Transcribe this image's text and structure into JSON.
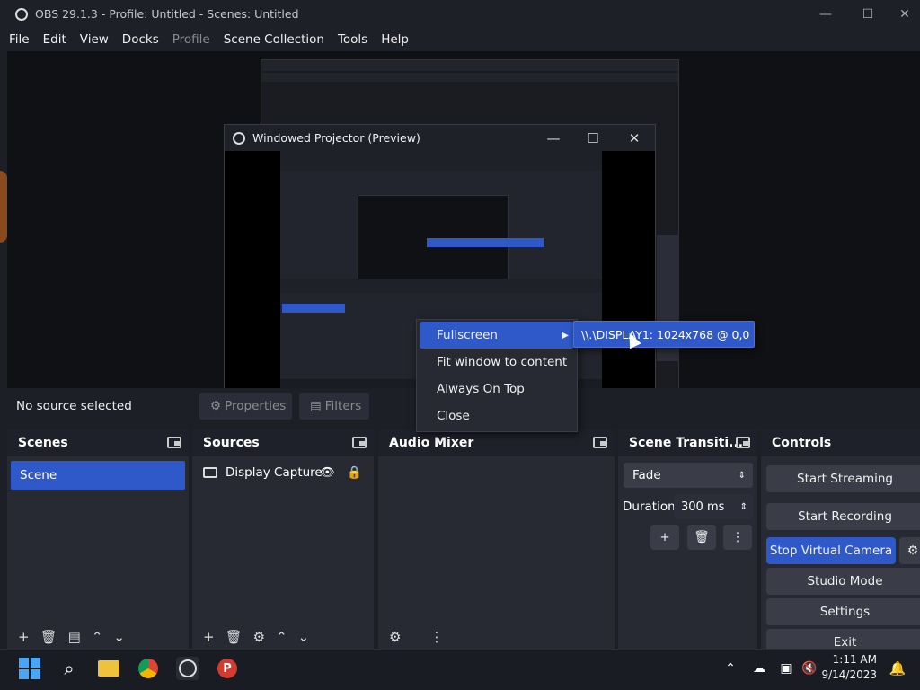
{
  "window": {
    "title": "OBS 29.1.3 - Profile: Untitled - Scenes: Untitled"
  },
  "menubar": {
    "items": [
      "File",
      "Edit",
      "View",
      "Docks",
      "Profile",
      "Scene Collection",
      "Tools",
      "Help"
    ]
  },
  "projector": {
    "title": "Windowed Projector (Preview)"
  },
  "context_menu": {
    "items": [
      "Fullscreen",
      "Fit window to content",
      "Always On Top",
      "Close"
    ],
    "submenu_item": "\\\\.\\DISPLAY1: 1024x768 @ 0,0"
  },
  "source_bar": {
    "status": "No source selected",
    "properties": "Properties",
    "filters": "Filters"
  },
  "docks": {
    "scenes": {
      "title": "Scenes",
      "items": [
        "Scene"
      ]
    },
    "sources": {
      "title": "Sources",
      "items": [
        "Display Capture"
      ]
    },
    "audio": {
      "title": "Audio Mixer"
    },
    "transitions": {
      "title": "Scene Transiti...",
      "type": "Fade",
      "duration_label": "Duration",
      "duration_value": "300 ms"
    },
    "controls": {
      "title": "Controls",
      "buttons": [
        "Start Streaming",
        "Start Recording",
        "Stop Virtual Camera",
        "Studio Mode",
        "Settings",
        "Exit"
      ]
    }
  },
  "taskbar": {
    "time": "1:11 AM",
    "date": "9/14/2023"
  }
}
